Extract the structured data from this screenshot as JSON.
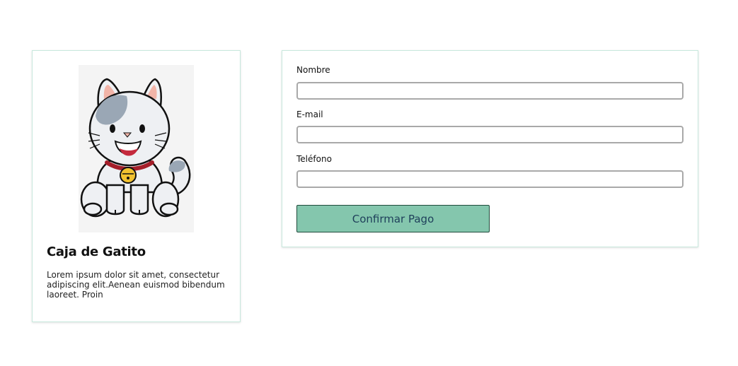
{
  "product": {
    "image_name": "cat-mascot-illustration",
    "title": "Caja de Gatito",
    "description": "Lorem ipsum dolor sit amet, consectetur adipiscing elit.Aenean euismod bibendum laoreet. Proin"
  },
  "form": {
    "name_label": "Nombre",
    "name_value": "",
    "email_label": "E-mail",
    "email_value": "",
    "phone_label": "Teléfono",
    "phone_value": "",
    "submit_label": "Confirmar Pago"
  },
  "colors": {
    "button_bg": "#84c6ad",
    "button_text": "#1e3f5a",
    "card_border": "#c8e8dd"
  }
}
